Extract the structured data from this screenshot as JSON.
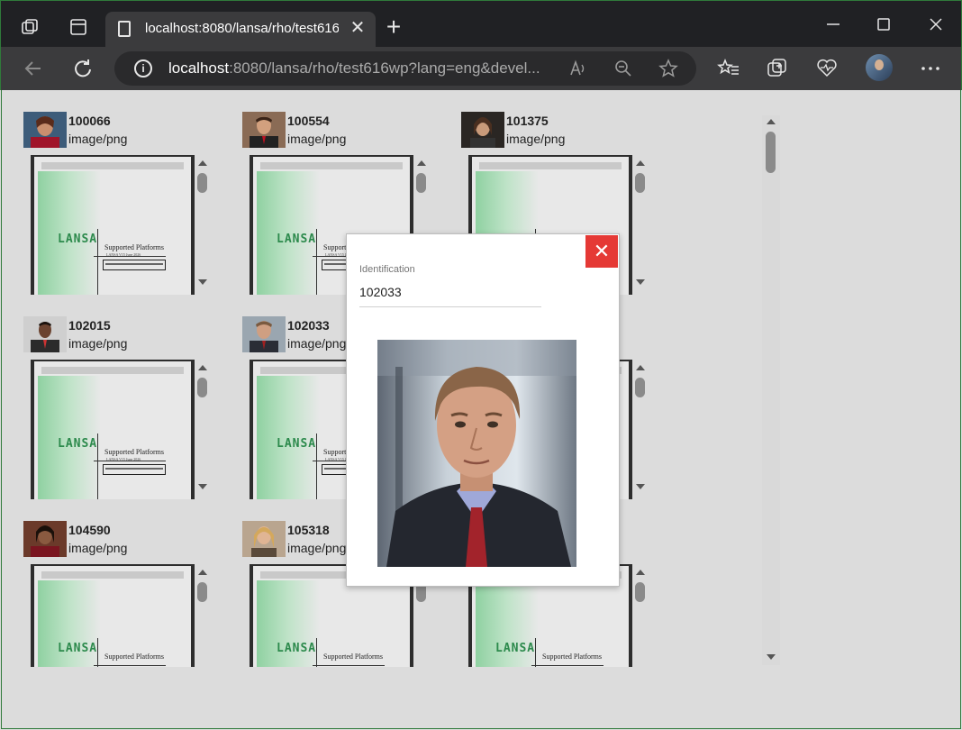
{
  "browser": {
    "tab_title": "localhost:8080/lansa/rho/test616",
    "tab_close": "✕",
    "new_tab": "+",
    "address_host": "localhost",
    "address_rest": ":8080/lansa/rho/test616wp?lang=eng&devel...",
    "info_glyph": "i"
  },
  "cards": [
    {
      "id": "100066",
      "type": "image/png"
    },
    {
      "id": "100554",
      "type": "image/png"
    },
    {
      "id": "101375",
      "type": "image/png"
    },
    {
      "id": "102015",
      "type": "image/png"
    },
    {
      "id": "102033",
      "type": "image/png"
    },
    {
      "id": "104590",
      "type": "image/png"
    },
    {
      "id": "105318",
      "type": "image/png"
    }
  ],
  "doc_preview": {
    "logo": "LANSA",
    "title": "Supported Platforms",
    "subtitle": "LANSA V15 June 2026"
  },
  "dialog": {
    "close_glyph": "✕",
    "field_label": "Identification",
    "field_value": "102033"
  }
}
